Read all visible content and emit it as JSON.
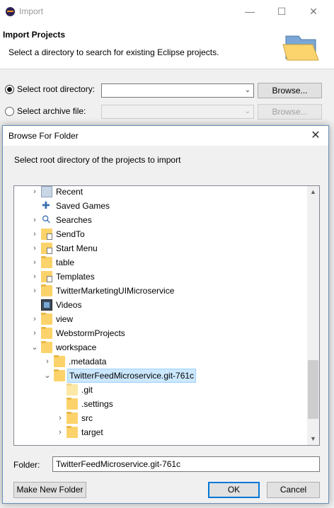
{
  "import_window": {
    "title": "Import",
    "controls": {
      "minimize": "—",
      "maximize": "☐",
      "close": "✕"
    },
    "header_title": "Import Projects",
    "header_desc": "Select a directory to search for existing Eclipse projects.",
    "root_dir_label": "Select root directory:",
    "root_dir_value": "",
    "archive_label": "Select archive file:",
    "archive_value": "",
    "browse_label": "Browse...",
    "browse_archive_label": "Browse..."
  },
  "dialog": {
    "title": "Browse For Folder",
    "close": "✕",
    "instruction": "Select root directory of the projects to import",
    "tree": [
      {
        "label": "Recent",
        "level": 1,
        "expander": "›",
        "icon": "network-folder-icon"
      },
      {
        "label": "Saved Games",
        "level": 1,
        "expander": "",
        "icon": "saved-games-icon"
      },
      {
        "label": "Searches",
        "level": 1,
        "expander": "›",
        "icon": "search-folder-icon"
      },
      {
        "label": "SendTo",
        "level": 1,
        "expander": "›",
        "icon": "shortcut-folder-icon"
      },
      {
        "label": "Start Menu",
        "level": 1,
        "expander": "›",
        "icon": "shortcut-folder-icon"
      },
      {
        "label": "table",
        "level": 1,
        "expander": "›",
        "icon": "folder-icon"
      },
      {
        "label": "Templates",
        "level": 1,
        "expander": "›",
        "icon": "shortcut-folder-icon"
      },
      {
        "label": "TwitterMarketingUIMicroservice",
        "level": 1,
        "expander": "›",
        "icon": "folder-icon"
      },
      {
        "label": "Videos",
        "level": 1,
        "expander": "",
        "icon": "videos-icon"
      },
      {
        "label": "view",
        "level": 1,
        "expander": "›",
        "icon": "folder-icon"
      },
      {
        "label": "WebstormProjects",
        "level": 1,
        "expander": "›",
        "icon": "folder-icon"
      },
      {
        "label": "workspace",
        "level": 1,
        "expander": "⌄",
        "icon": "folder-icon"
      },
      {
        "label": ".metadata",
        "level": 2,
        "expander": "›",
        "icon": "folder-icon"
      },
      {
        "label": "TwitterFeedMicroservice.git-761c",
        "level": 2,
        "expander": "⌄",
        "icon": "folder-icon",
        "selected": true
      },
      {
        "label": ".git",
        "level": 3,
        "expander": "",
        "icon": "folder-icon-light"
      },
      {
        "label": ".settings",
        "level": 3,
        "expander": "",
        "icon": "folder-icon"
      },
      {
        "label": "src",
        "level": 3,
        "expander": "›",
        "icon": "folder-icon"
      },
      {
        "label": "target",
        "level": 3,
        "expander": "›",
        "icon": "folder-icon"
      }
    ],
    "folder_label": "Folder:",
    "folder_value": "TwitterFeedMicroservice.git-761c",
    "make_new_folder_label": "Make New Folder",
    "ok_label": "OK",
    "cancel_label": "Cancel"
  }
}
